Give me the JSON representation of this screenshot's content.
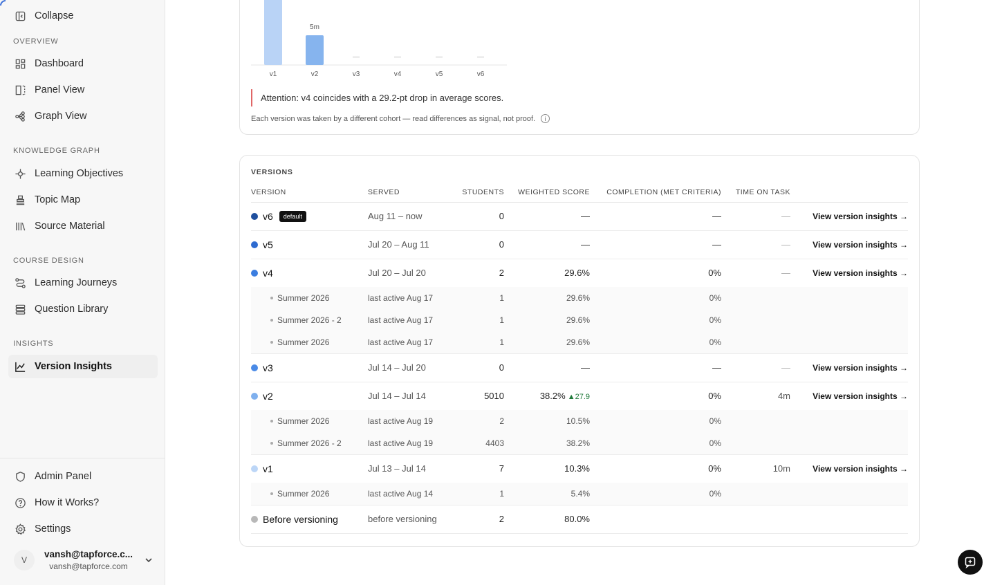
{
  "sidebar": {
    "collapse_label": "Collapse",
    "sections": {
      "overview": "OVERVIEW",
      "knowledge_graph": "KNOWLEDGE GRAPH",
      "course_design": "COURSE DESIGN",
      "insights": "INSIGHTS"
    },
    "items": {
      "dashboard": "Dashboard",
      "panel_view": "Panel View",
      "graph_view": "Graph View",
      "learning_objectives": "Learning Objectives",
      "topic_map": "Topic Map",
      "source_material": "Source Material",
      "learning_journeys": "Learning Journeys",
      "question_library": "Question Library",
      "version_insights": "Version Insights"
    },
    "bottom": {
      "admin_panel": "Admin Panel",
      "how_it_works": "How it Works?",
      "settings": "Settings"
    },
    "user": {
      "initial": "V",
      "name": "vansh@tapforce.c...",
      "email": "vansh@tapforce.com"
    }
  },
  "chart": {
    "categories": [
      "v1",
      "v2",
      "v3",
      "v4",
      "v5",
      "v6"
    ],
    "bar_labels": [
      "",
      "5m",
      "",
      "",
      "",
      ""
    ],
    "attention": "Attention: v4 coincides with a 29.2-pt drop in average scores.",
    "note": "Each version was taken by a different cohort — read differences as signal, not proof.",
    "info_icon": "i"
  },
  "chart_data": {
    "type": "bar",
    "categories": [
      "v1",
      "v2",
      "v3",
      "v4",
      "v5",
      "v6"
    ],
    "values": [
      null,
      5,
      null,
      null,
      null,
      null
    ],
    "data_labels": [
      "",
      "5m",
      "—",
      "—",
      "—",
      "—"
    ],
    "ylabel": ""
  },
  "versions": {
    "title": "VERSIONS",
    "headers": {
      "version": "VERSION",
      "served": "SERVED",
      "students": "STUDENTS",
      "weighted_score": "WEIGHTED SCORE",
      "completion": "COMPLETION (MET CRITERIA)",
      "time_on_task": "TIME ON TASK"
    },
    "link_label": "View version insights →",
    "default_badge": "default",
    "rows": [
      {
        "version": "v6",
        "served": "Aug 11 – now",
        "students": "0",
        "score": "—",
        "completion": "—",
        "time": "—",
        "color": "#1f4f9e"
      },
      {
        "version": "v5",
        "served": "Jul 20 – Aug 11",
        "students": "0",
        "score": "—",
        "completion": "—",
        "time": "—",
        "color": "#2e6bd0"
      },
      {
        "version": "v4",
        "served": "Jul 20 – Jul 20",
        "students": "2",
        "score": "29.6%",
        "completion": "0%",
        "time": "—",
        "color": "#3b7ee0"
      },
      {
        "version": "v3",
        "served": "Jul 14 – Jul 20",
        "students": "0",
        "score": "—",
        "completion": "—",
        "time": "—",
        "color": "#4a8ae6"
      },
      {
        "version": "v2",
        "served": "Jul 14 – Jul 14",
        "students": "5010",
        "score": "38.2%",
        "delta": "▲27.9",
        "completion": "0%",
        "time": "4m",
        "color": "#7fb0ee"
      },
      {
        "version": "v1",
        "served": "Jul 13 – Jul 14",
        "students": "7",
        "score": "10.3%",
        "completion": "0%",
        "time": "10m",
        "color": "#bcd6f7"
      },
      {
        "version": "Before versioning",
        "served": "before versioning",
        "students": "2",
        "score": "80.0%",
        "color": "#b8b8b8"
      }
    ],
    "v4_subs": [
      {
        "name": "Summer 2026",
        "served": "last active Aug 17",
        "students": "1",
        "score": "29.6%",
        "completion": "0%"
      },
      {
        "name": "Summer 2026 - 2",
        "served": "last active Aug 17",
        "students": "1",
        "score": "29.6%",
        "completion": "0%"
      },
      {
        "name": "Summer 2026",
        "served": "last active Aug 17",
        "students": "1",
        "score": "29.6%",
        "completion": "0%"
      }
    ],
    "v2_subs": [
      {
        "name": "Summer 2026",
        "served": "last active Aug 19",
        "students": "2",
        "score": "10.5%",
        "completion": "0%"
      },
      {
        "name": "Summer 2026 - 2",
        "served": "last active Aug 19",
        "students": "4403",
        "score": "38.2%",
        "completion": "0%"
      }
    ],
    "v1_subs": [
      {
        "name": "Summer 2026",
        "served": "last active Aug 14",
        "students": "1",
        "score": "5.4%",
        "completion": "0%"
      }
    ]
  },
  "colors": {
    "accent": "#3b6fd8",
    "positive": "#1f7a3a",
    "attention": "#e06666",
    "bar_v1": "#b9d3f6",
    "bar_v2": "#86b4ee"
  }
}
